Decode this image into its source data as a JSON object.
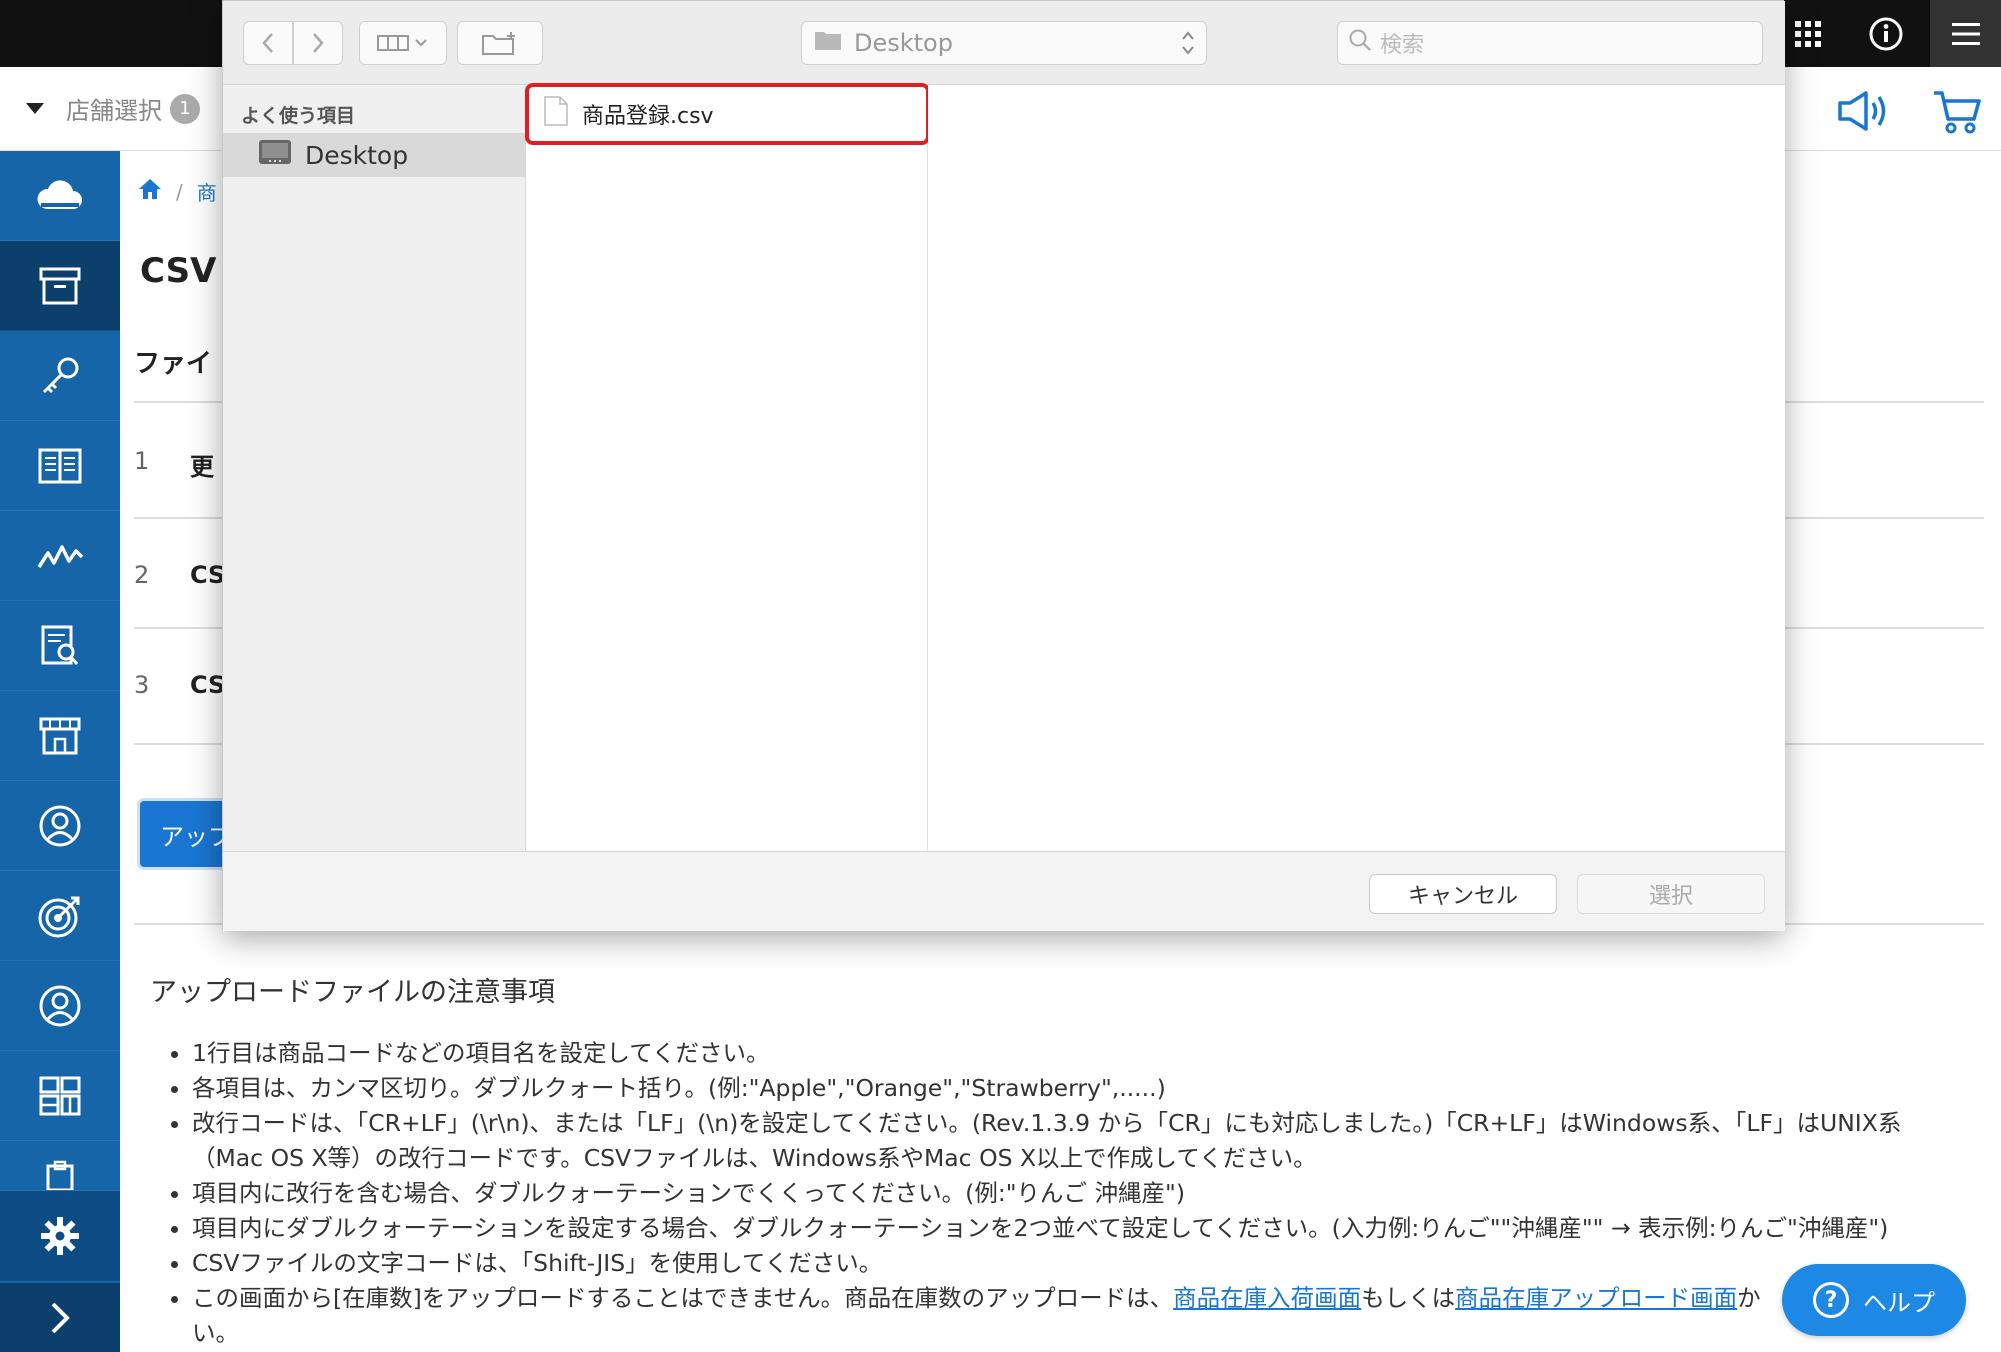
{
  "store": {
    "label": "店舗選択",
    "count": "1"
  },
  "breadcrumb": {
    "crumb": "商"
  },
  "page": {
    "title": "CSV",
    "section": "ファイ",
    "steps": [
      {
        "num": "1",
        "text": "更"
      },
      {
        "num": "2",
        "text": "CS"
      },
      {
        "num": "3",
        "text": "CS"
      }
    ],
    "upload_label": "アップ"
  },
  "notes": {
    "title": "アップロードファイルの注意事項",
    "items": [
      "1行目は商品コードなどの項目名を設定してください。",
      "各項目は、カンマ区切り。ダブルクォート括り。(例:\"Apple\",\"Orange\",\"Strawberry\",.....)",
      "改行コードは、「CR+LF」(\\r\\n)、または「LF」(\\n)を設定してください。(Rev.1.3.9 から「CR」にも対応しました。)「CR+LF」はWindows系、「LF」はUNIX系（Mac OS X等）の改行コードです。CSVファイルは、Windows系やMac OS X以上で作成してください。",
      "項目内に改行を含む場合、ダブルクォーテーションでくくってください。(例:\"りんご 沖縄産\")",
      "項目内にダブルクォーテーションを設定する場合、ダブルクォーテーションを2つ並べて設定してください。(入力例:りんご\"\"沖縄産\"\" → 表示例:りんご\"沖縄産\")",
      "CSVファイルの文字コードは、「Shift-JIS」を使用してください。"
    ],
    "last_prefix": "この画面から[在庫数]をアップロードすることはできません。商品在庫数のアップロードは、",
    "link1": "商品在庫入荷画面",
    "mid": "もしくは",
    "link2": "商品在庫アップロード画面",
    "last_suffix": "か",
    "last_tail": "い。"
  },
  "help": {
    "label": "ヘルプ"
  },
  "dialog": {
    "location": "Desktop",
    "search_placeholder": "検索",
    "favorites_header": "よく使う項目",
    "favorite_item": "Desktop",
    "file_name": "商品登録.csv",
    "cancel_label": "キャンセル",
    "select_label": "選択"
  },
  "colors": {
    "sidebar": "#1565a8",
    "accent": "#1976d2",
    "highlight": "#e02020"
  }
}
